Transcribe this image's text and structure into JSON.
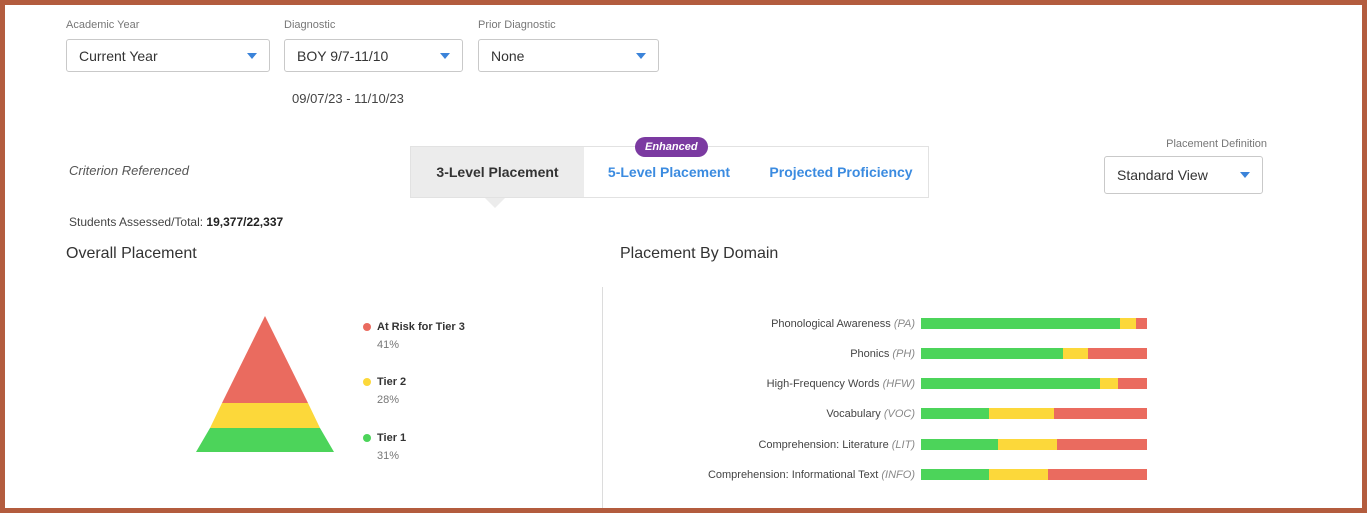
{
  "filters": {
    "academic_year": {
      "label": "Academic Year",
      "value": "Current Year"
    },
    "diagnostic": {
      "label": "Diagnostic",
      "value": "BOY 9/7-11/10",
      "date_range": "09/07/23 - 11/10/23"
    },
    "prior_diagnostic": {
      "label": "Prior Diagnostic",
      "value": "None"
    }
  },
  "criterion": "Criterion Referenced",
  "tabs": [
    {
      "label": "3-Level Placement"
    },
    {
      "label": "5-Level Placement"
    },
    {
      "label": "Projected Proficiency"
    }
  ],
  "badge": "Enhanced",
  "placement_definition": {
    "label": "Placement Definition",
    "value": "Standard View"
  },
  "assessed": {
    "label": "Students Assessed/Total: ",
    "value": "19,377/22,337"
  },
  "overall": {
    "title": "Overall Placement",
    "levels": [
      {
        "name": "At Risk for Tier 3",
        "pct": "41%",
        "color": "#ea6b5f"
      },
      {
        "name": "Tier 2",
        "pct": "28%",
        "color": "#fcd83a"
      },
      {
        "name": "Tier 1",
        "pct": "31%",
        "color": "#4cd45a"
      }
    ]
  },
  "domain": {
    "title": "Placement By Domain",
    "rows": [
      {
        "name": "Phonological Awareness",
        "abbr": "(PA)",
        "green": 88,
        "yellow": 7,
        "red": 5
      },
      {
        "name": "Phonics",
        "abbr": "(PH)",
        "green": 63,
        "yellow": 11,
        "red": 26
      },
      {
        "name": "High-Frequency Words",
        "abbr": "(HFW)",
        "green": 79,
        "yellow": 8,
        "red": 13
      },
      {
        "name": "Vocabulary",
        "abbr": "(VOC)",
        "green": 30,
        "yellow": 29,
        "red": 41
      },
      {
        "name": "Comprehension: Literature",
        "abbr": "(LIT)",
        "green": 34,
        "yellow": 26,
        "red": 40
      },
      {
        "name": "Comprehension: Informational Text",
        "abbr": "(INFO)",
        "green": 30,
        "yellow": 26,
        "red": 44
      }
    ]
  }
}
